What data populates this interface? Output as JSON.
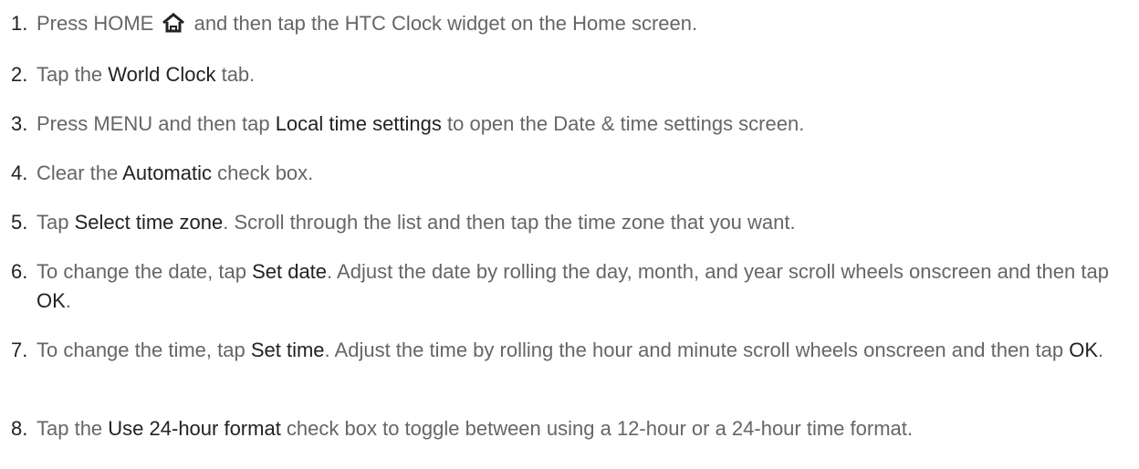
{
  "steps": [
    {
      "num": "1.",
      "a": "Press HOME ",
      "icon": "home-icon",
      "b": " and then tap the HTC Clock widget on the Home screen."
    },
    {
      "num": "2.",
      "a": "Tap the ",
      "bold1": "World Clock",
      "b": " tab."
    },
    {
      "num": "3.",
      "a": "Press MENU and then tap ",
      "bold1": "Local time settings",
      "b": " to open the Date & time settings screen."
    },
    {
      "num": "4.",
      "a": "Clear the ",
      "bold1": "Automatic",
      "b": " check box."
    },
    {
      "num": "5.",
      "a": "Tap ",
      "bold1": "Select time zone",
      "b": ". Scroll through the list and then tap the time zone that you want."
    },
    {
      "num": "6.",
      "a": "To change the date, tap ",
      "bold1": "Set date",
      "b": ". Adjust the date by rolling the day, month, and year scroll wheels onscreen and then tap ",
      "bold2": "OK",
      "c": "."
    },
    {
      "num": "7.",
      "a": "To change the time, tap ",
      "bold1": "Set time",
      "b": ". Adjust the time by rolling the hour and minute scroll wheels onscreen and then tap ",
      "bold2": "OK",
      "c": "."
    },
    {
      "num": "8.",
      "a": "Tap the ",
      "bold1": "Use 24-hour format",
      "b": " check box to toggle between using a 12-hour or a 24-hour time format."
    }
  ]
}
